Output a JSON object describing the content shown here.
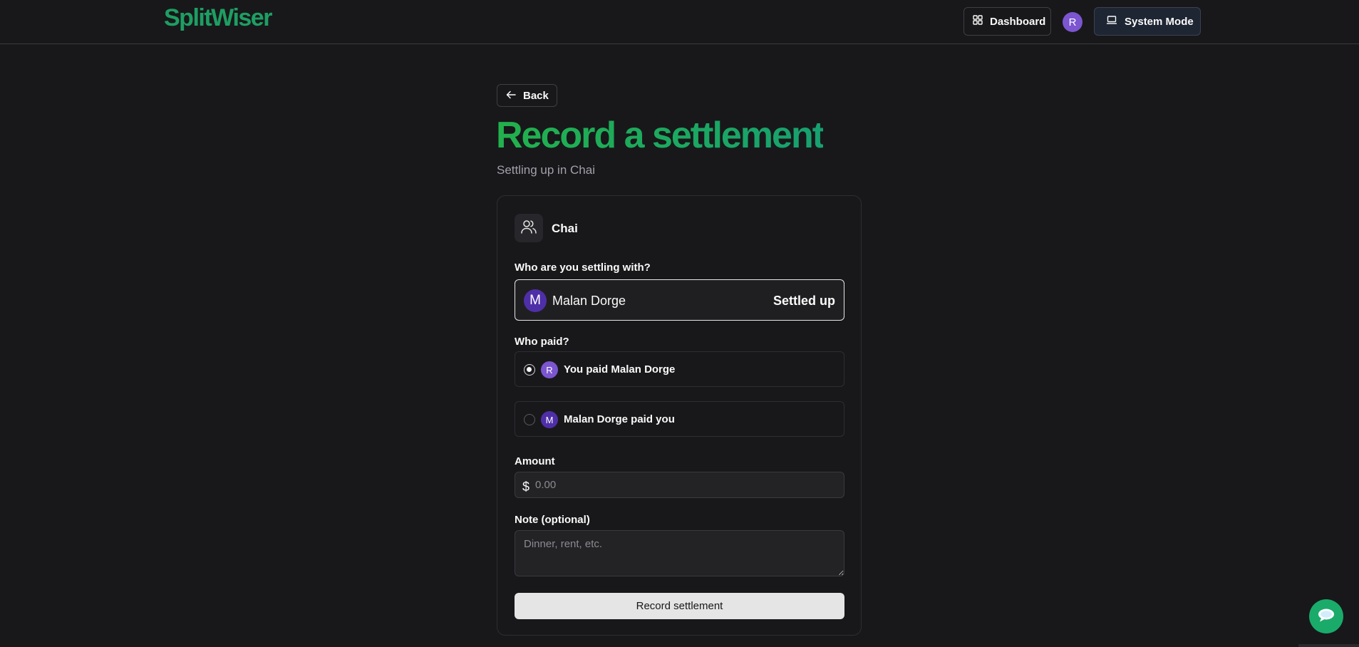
{
  "header": {
    "logo": "SplitWiser",
    "dashboard_label": "Dashboard",
    "user_initial": "R",
    "theme_label": "System Mode"
  },
  "page": {
    "back_label": "Back",
    "title": "Record a settlement",
    "subtitle": "Settling up in Chai"
  },
  "form": {
    "group_name": "Chai",
    "settle_with_label": "Who are you settling with?",
    "selected_person": {
      "initial": "M",
      "name": "Malan Dorge",
      "status": "Settled up"
    },
    "who_paid_label": "Who paid?",
    "payer_options": [
      {
        "initial": "R",
        "label": "You paid Malan Dorge",
        "selected": true,
        "avatar_color": "#7c55d1"
      },
      {
        "initial": "M",
        "label": "Malan Dorge paid you",
        "selected": false,
        "avatar_color": "#4f2fa8"
      }
    ],
    "amount_label": "Amount",
    "currency_symbol": "$",
    "amount_placeholder": "0.00",
    "note_label": "Note (optional)",
    "note_placeholder": "Dinner, rent, etc.",
    "submit_label": "Record settlement"
  },
  "colors": {
    "brand": "#1e9e63",
    "background": "#18181a",
    "avatar_user": "#7c55d1",
    "avatar_other": "#4f2fa8"
  },
  "icons": {
    "dashboard": "grid-icon",
    "theme": "laptop-icon",
    "back": "arrow-left-icon",
    "group": "users-icon",
    "chat": "chat-bubble-icon"
  }
}
